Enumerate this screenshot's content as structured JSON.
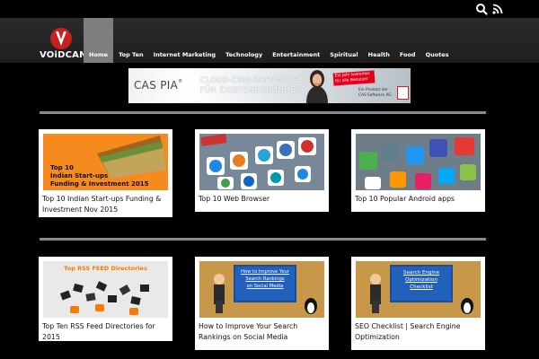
{
  "topbar": {
    "icons": [
      "search-icon",
      "rss-icon"
    ]
  },
  "logo": {
    "text": "VOiDCAN"
  },
  "nav": {
    "items": [
      {
        "label": "Home",
        "active": true
      },
      {
        "label": "Top Ten"
      },
      {
        "label": "Internet Marketing"
      },
      {
        "label": "Technology"
      },
      {
        "label": "Entertainment"
      },
      {
        "label": "Spiritual"
      },
      {
        "label": "Health"
      },
      {
        "label": "Food"
      },
      {
        "label": "Quotes"
      }
    ]
  },
  "banner": {
    "brand": "CAS PIA",
    "tagline_1": "CLOUD-CRM-SOFTWARE",
    "tagline_2": "FÜR EXISTENZGRÜNDER",
    "promo_1": "Ein Jahr kostenlos",
    "promo_2": "für alle Benutzer",
    "product_1": "Ein Produkt der",
    "product_2": "CAS Software AG"
  },
  "cards": [
    {
      "title": "Top 10 Indian Start-ups Funding & Investment Nov 2015",
      "thumb_text_1": "Top 10",
      "thumb_text_2": "Indian Start-ups",
      "thumb_text_3": "Funding & Investment 2015"
    },
    {
      "title": "Top 10 Web Browser"
    },
    {
      "title": "Top 10 Popular Android apps"
    },
    {
      "title": "Top Ten RSS Feed Directories for 2015",
      "thumb_text_1": "Top RSS FEED Directories"
    },
    {
      "title": "How to Improve Your Search Rankings on Social Media",
      "thumb_text_1": "How to Improve Your",
      "thumb_text_2": "Search Rankings",
      "thumb_text_3": "on Social Media"
    },
    {
      "title": "SEO Checklist | Search Engine Optimization",
      "thumb_text_1": "Search Engine",
      "thumb_text_2": "Optimization",
      "thumb_text_3": "Checklist"
    }
  ],
  "colors": {
    "background": "#000000",
    "nav_active": "#7e7e7e",
    "logo_red": "#c62020",
    "card_bg": "#ffffff",
    "divider": "#8a8a8a"
  }
}
